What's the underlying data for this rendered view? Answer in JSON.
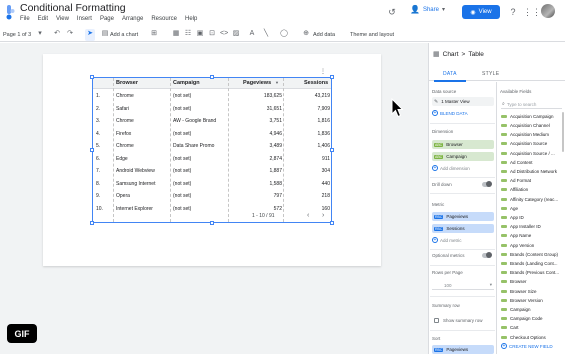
{
  "app": {
    "title": "Conditional Formatting",
    "menu": [
      "File",
      "Edit",
      "View",
      "Insert",
      "Page",
      "Arrange",
      "Resource",
      "Help"
    ],
    "share_label": "Share",
    "view_label": "View"
  },
  "toolbar": {
    "page_indicator": "Page 1 of 3",
    "add_chart": "Add a chart",
    "add_data": "Add data",
    "theme_layout": "Theme and layout"
  },
  "table": {
    "headers": [
      "Browser",
      "Campaign",
      "Pageviews",
      "Sessions"
    ],
    "sort_indicator": "▼",
    "rows": [
      [
        "1.",
        "Chrome",
        "(not set)",
        "183,625",
        "43,219"
      ],
      [
        "2.",
        "Safari",
        "(not set)",
        "31,651",
        "7,909"
      ],
      [
        "3.",
        "Chrome",
        "AW - Google Brand",
        "3,751",
        "1,816"
      ],
      [
        "4.",
        "Firefox",
        "(not set)",
        "4,946",
        "1,836"
      ],
      [
        "5.",
        "Chrome",
        "Data Share Promo",
        "3,489",
        "1,406"
      ],
      [
        "6.",
        "Edge",
        "(not set)",
        "2,874",
        "911"
      ],
      [
        "7.",
        "Android Webview",
        "(not set)",
        "1,887",
        "304"
      ],
      [
        "8.",
        "Samsung Internet",
        "(not set)",
        "1,588",
        "440"
      ],
      [
        "9.",
        "Opera",
        "(not set)",
        "797",
        "218"
      ],
      [
        "10.",
        "Internet Explorer",
        "(not set)",
        "572",
        "160"
      ]
    ],
    "pagination": "1 - 10 / 91"
  },
  "overlay": {
    "gif_badge": "GIF"
  },
  "panel": {
    "breadcrumb_chart": "Chart",
    "breadcrumb_sep": ">",
    "breadcrumb_type": "Table",
    "tabs": [
      "DATA",
      "STYLE"
    ],
    "data_source_label": "Data source",
    "data_source_value": "1 Master View",
    "blend_data": "BLEND DATA",
    "dimension_label": "Dimension",
    "dimensions": [
      "Browser",
      "Campaign"
    ],
    "add_dimension": "Add dimension",
    "drill_down": "Drill down",
    "metric_label": "Metric",
    "metrics": [
      "Pageviews",
      "Sessions"
    ],
    "add_metric": "Add metric",
    "optional_metrics": "Optional metrics",
    "rows_per_page_label": "Rows per Page",
    "rows_per_page_value": "100",
    "summary_row_label": "Summary row",
    "show_summary_row": "Show summary row",
    "sort_label": "Sort",
    "sort_value": "Pageviews",
    "type_abc": "ABC",
    "type_rbc": "RBC",
    "available_fields_label": "Available Fields",
    "search_placeholder": "Type to search",
    "available_fields": [
      "Acquisition Campaign",
      "Acquisition Channel",
      "Acquisition Medium",
      "Acquisition Source",
      "Acquisition Source / ...",
      "Ad Content",
      "Ad Distribution Network",
      "Ad Format",
      "Affiliation",
      "Affinity Category (reac...",
      "Age",
      "App ID",
      "App Installer ID",
      "App Name",
      "App Version",
      "Brands (Content Group)",
      "Brands (Landing Cont...",
      "Brands (Previous Cont...",
      "Browser",
      "Browser Size",
      "Browser Version",
      "Campaign",
      "Campaign Code",
      "Cart",
      "Checkout Options"
    ],
    "create_new_field": "CREATE NEW FIELD"
  }
}
